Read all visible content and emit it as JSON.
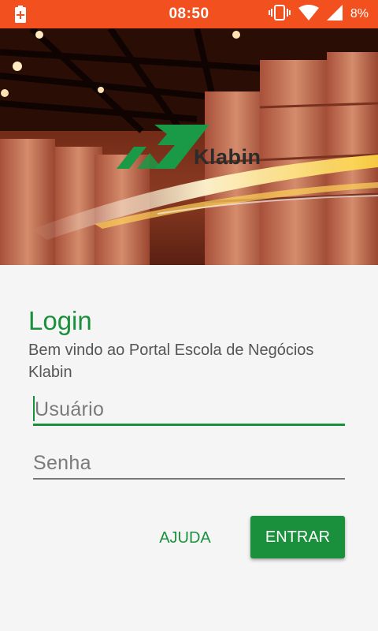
{
  "status_bar": {
    "time": "08:50",
    "battery_percent": "8%",
    "icons": [
      "battery-charging-icon",
      "vibrate-icon",
      "wifi-icon",
      "signal-icon",
      "battery-icon"
    ]
  },
  "banner": {
    "brand_name": "Klabin"
  },
  "login": {
    "title": "Login",
    "welcome": "Bem vindo ao Portal Escola de Negócios Klabin",
    "username_placeholder": "Usuário",
    "password_placeholder": "Senha",
    "help_label": "AJUDA",
    "enter_label": "ENTRAR"
  },
  "colors": {
    "status_bar": "#f2511f",
    "accent_green": "#1a8f3c",
    "background": "#f5f5f5"
  }
}
